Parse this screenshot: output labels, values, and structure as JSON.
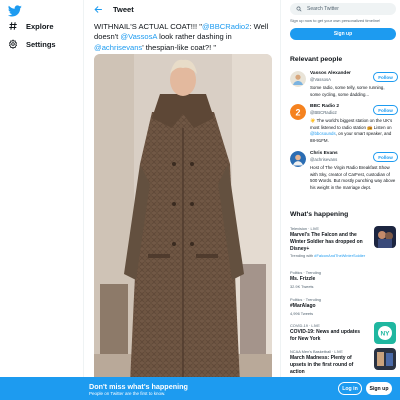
{
  "colors": {
    "accent": "#1d9bf0",
    "text": "#0f1419",
    "muted": "#536471"
  },
  "nav": {
    "logo_icon": "bird-icon",
    "items": [
      {
        "label": "Explore",
        "icon": "hashtag-icon"
      },
      {
        "label": "Settings",
        "icon": "gear-icon"
      }
    ]
  },
  "header": {
    "title": "Tweet",
    "back_icon": "arrow-left-icon"
  },
  "tweet": {
    "text_1": "WITHNAIL'S ACTUAL COAT!!! \"",
    "mention_1": "@BBCRadio2",
    "text_2": ": Well doesn't ",
    "mention_2": "@VassosA",
    "text_3": " look rather dashing in ",
    "mention_3": "@achrisevans",
    "text_4": "' thespian-like coat?! \"",
    "image_alt": "Man wearing a long brown tweed coat"
  },
  "search": {
    "placeholder": "Search Twitter",
    "icon": "search-icon"
  },
  "signup_note": "Sign up now to get your own personalized timeline!",
  "signup_button": "Sign up",
  "relevant": {
    "title": "Relevant people",
    "people": [
      {
        "name": "Vassos Alexander",
        "handle": "@VassosA",
        "bio": "Some radio, some telly, some running, some cycling, some dadding...",
        "follow": "Follow"
      },
      {
        "name": "BBC Radio 2",
        "handle": "@BBCRadio2",
        "bio_1": "☀️ The world's biggest station on the UK's most listened to radio station 📻 Listen on ",
        "bio_link": "@bbcsounds",
        "bio_2": ", on your smart speaker, and 88-91FM.",
        "follow": "Follow"
      },
      {
        "name": "Chris Evans",
        "handle": "@achrisevans",
        "bio": "Host of The Virgin Radio Breakfast Show with Sky, creator of CarFest, custodian of 500 Words. But mostly punching way above his weight in the marriage dept.",
        "follow": "Follow"
      }
    ]
  },
  "happening": {
    "title": "What's happening",
    "trends": [
      {
        "meta": "Television · LIVE",
        "title": "Marvel's The Falcon and the Winter Soldier has dropped on Disney+",
        "sub_prefix": "Trending with ",
        "sub_link": "#FalconAndTheWinterSoldier"
      },
      {
        "meta": "Politics · Trending",
        "title": "Ms. Frizzle",
        "sub": "32.9K Tweets"
      },
      {
        "meta": "Politics · Trending",
        "title": "#MarAlago",
        "sub": "4,996 Tweets"
      },
      {
        "meta": "COVID-19 · LIVE",
        "title": "COVID-19: News and updates for New York"
      },
      {
        "meta": "NCAA Men's Basketball · LIVE",
        "title": "March Madness: Plenty of upsets in the first round of action"
      }
    ]
  },
  "banner": {
    "title": "Don't miss what's happening",
    "subtitle": "People on Twitter are the first to know.",
    "login": "Log in",
    "signup": "Sign up"
  }
}
